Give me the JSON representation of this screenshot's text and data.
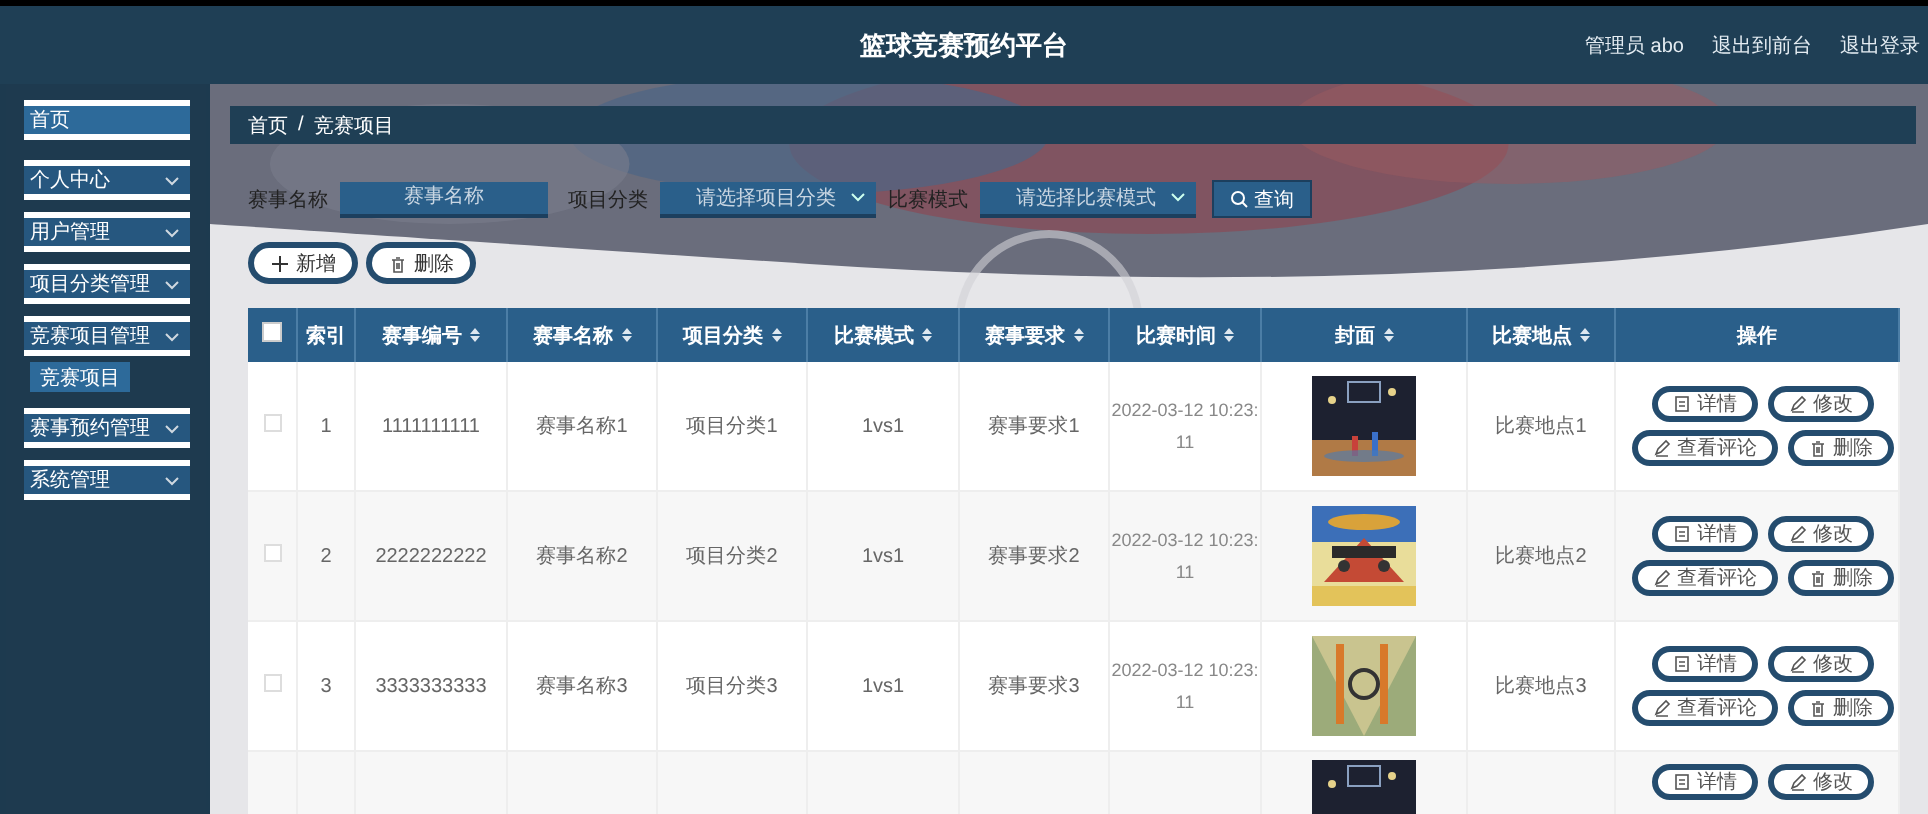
{
  "header": {
    "title": "篮球竞赛预约平台",
    "links": [
      {
        "label": "管理员 abo"
      },
      {
        "label": "退出到前台"
      },
      {
        "label": "退出登录"
      }
    ]
  },
  "sidebar": {
    "items": [
      {
        "label": "首页",
        "selected": true
      },
      {
        "label": "个人中心",
        "selected": false
      },
      {
        "label": "用户管理",
        "selected": false
      },
      {
        "label": "项目分类管理",
        "selected": false
      },
      {
        "label": "竞赛项目管理",
        "selected": false,
        "children": [
          {
            "label": "竞赛项目",
            "selected": true
          }
        ]
      },
      {
        "label": "赛事预约管理",
        "selected": false
      },
      {
        "label": "系统管理",
        "selected": false
      }
    ]
  },
  "breadcrumb": [
    {
      "label": "首页"
    },
    {
      "label": "/"
    },
    {
      "label": "竞赛项目"
    }
  ],
  "search": {
    "fields": [
      {
        "kind": "input",
        "label": "赛事名称",
        "placeholder": "赛事名称"
      },
      {
        "kind": "select",
        "label": "项目分类",
        "placeholder": "请选择项目分类"
      },
      {
        "kind": "select",
        "label": "比赛模式",
        "placeholder": "请选择比赛模式"
      }
    ],
    "button": "查询"
  },
  "actions": [
    {
      "kind": "add",
      "label": "新增"
    },
    {
      "kind": "delete",
      "label": "删除"
    }
  ],
  "table": {
    "select_all": {
      "checked": false
    },
    "columns": [
      {
        "label": "索引",
        "sortable": false
      },
      {
        "label": "赛事编号",
        "sortable": true
      },
      {
        "label": "赛事名称",
        "sortable": true
      },
      {
        "label": "项目分类",
        "sortable": true
      },
      {
        "label": "比赛模式",
        "sortable": true
      },
      {
        "label": "赛事要求",
        "sortable": true
      },
      {
        "label": "比赛时间",
        "sortable": true
      },
      {
        "label": "封面",
        "sortable": true
      },
      {
        "label": "比赛地点",
        "sortable": true
      },
      {
        "label": "操作",
        "sortable": false
      }
    ],
    "rows": [
      {
        "selected": false,
        "cells": [
          "1",
          "1111111111",
          "赛事名称1",
          "项目分类1",
          "1vs1",
          "赛事要求1",
          "2022-03-12 10:23:11"
        ],
        "place": "比赛地点1",
        "buttons": [
          {
            "kind": "detail",
            "label": "详情"
          },
          {
            "kind": "edit",
            "label": "修改"
          },
          {
            "kind": "edit",
            "label": "查看评论"
          },
          {
            "kind": "delete",
            "label": "删除"
          }
        ]
      },
      {
        "selected": false,
        "cells": [
          "2",
          "2222222222",
          "赛事名称2",
          "项目分类2",
          "1vs1",
          "赛事要求2",
          "2022-03-12 10:23:11"
        ],
        "place": "比赛地点2",
        "buttons": [
          {
            "kind": "detail",
            "label": "详情"
          },
          {
            "kind": "edit",
            "label": "修改"
          },
          {
            "kind": "edit",
            "label": "查看评论"
          },
          {
            "kind": "delete",
            "label": "删除"
          }
        ]
      },
      {
        "selected": false,
        "cells": [
          "3",
          "3333333333",
          "赛事名称3",
          "项目分类3",
          "1vs1",
          "赛事要求3",
          "2022-03-12 10:23:11"
        ],
        "place": "比赛地点3",
        "buttons": [
          {
            "kind": "detail",
            "label": "详情"
          },
          {
            "kind": "edit",
            "label": "修改"
          },
          {
            "kind": "edit",
            "label": "查看评论"
          },
          {
            "kind": "delete",
            "label": "删除"
          }
        ]
      },
      {
        "buttons": [
          {
            "kind": "detail",
            "label": "详情"
          },
          {
            "kind": "edit",
            "label": "修改"
          }
        ]
      }
    ]
  }
}
